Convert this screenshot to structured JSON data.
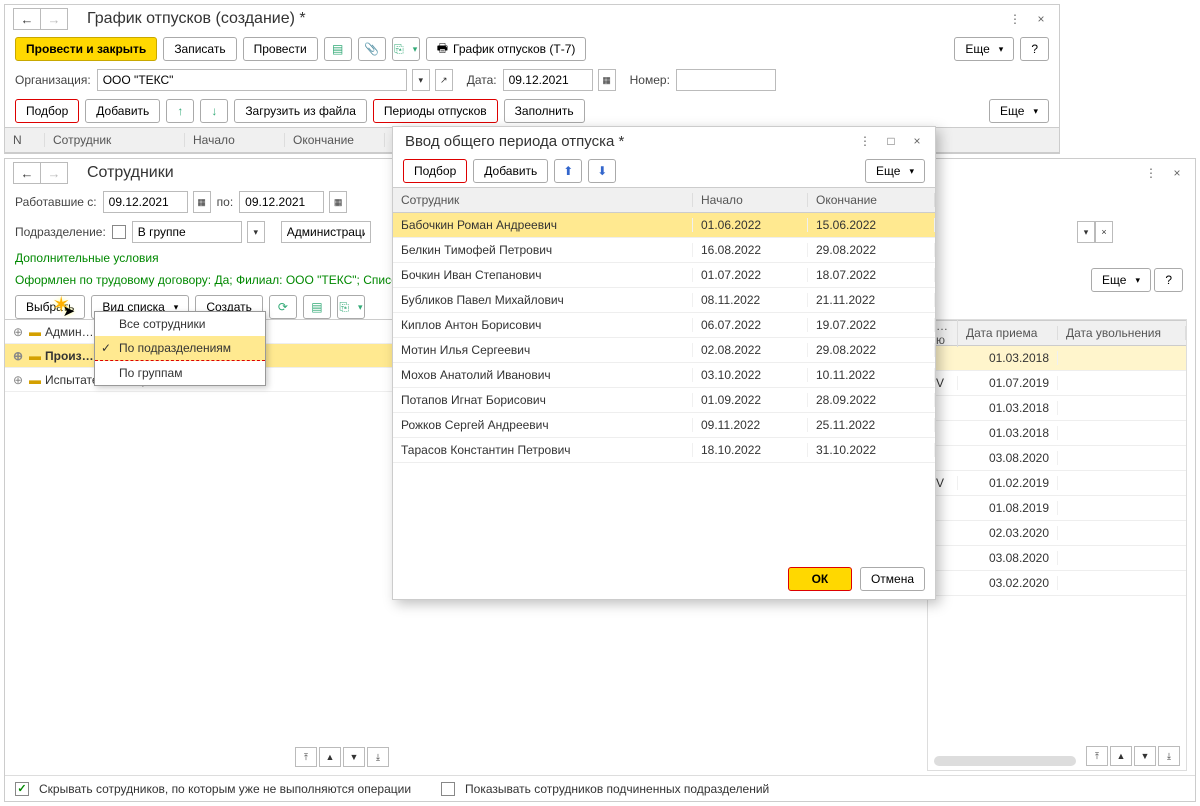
{
  "main_window": {
    "title": "График отпусков (создание) *",
    "toolbar": {
      "post_close": "Провести и закрыть",
      "save": "Записать",
      "post": "Провести",
      "print": "График отпусков (Т-7)",
      "more": "Еще",
      "help": "?"
    },
    "org_label": "Организация:",
    "org_value": "ООО \"ТЕКС\"",
    "date_label": "Дата:",
    "date_value": "09.12.2021",
    "number_label": "Номер:",
    "number_value": "",
    "row2": {
      "select": "Подбор",
      "add": "Добавить",
      "load_file": "Загрузить из файла",
      "periods": "Периоды отпусков",
      "fill": "Заполнить",
      "more": "Еще"
    },
    "cols": {
      "n": "N",
      "emp": "Сотрудник",
      "start": "Начало",
      "end": "Окончание"
    }
  },
  "emp_window": {
    "title": "Сотрудники",
    "worked_from_label": "Работавшие с:",
    "date_from": "09.12.2021",
    "date_to_label": "по:",
    "date_to": "09.12.2021",
    "dept_label": "Подразделение:",
    "in_group": "В группе",
    "admin": "Администрация",
    "extra_cond": "Дополнительные условия",
    "filter_text": "Оформлен по трудовому договору: Да; Филиал: ООО \"ТЕКС\"; Список н",
    "btns": {
      "select": "Выбрать",
      "list_type": "Вид списка",
      "create": "Создать"
    },
    "tree": [
      "Админ…",
      "Произ…",
      "Испытательный цех"
    ],
    "menu": [
      "Все сотрудники",
      "По подразделениям",
      "По группам"
    ],
    "right_cols": {
      "c1": "…ю",
      "c2": "Дата приема",
      "c3": "Дата увольнения"
    },
    "right_rows": [
      {
        "d": "01.03.2018"
      },
      {
        "v": "V",
        "d": "01.07.2019"
      },
      {
        "d": "01.03.2018"
      },
      {
        "d": "01.03.2018"
      },
      {
        "d": "03.08.2020"
      },
      {
        "v": "V",
        "d": "01.02.2019"
      },
      {
        "d": "01.08.2019"
      },
      {
        "d": "02.03.2020"
      },
      {
        "d": "03.08.2020"
      },
      {
        "d": "03.02.2020"
      }
    ],
    "more": "Еще",
    "help": "?",
    "footer": {
      "hide_emp": "Скрывать сотрудников, по которым уже не выполняются операции",
      "show_sub": "Показывать сотрудников подчиненных подразделений"
    }
  },
  "period_dialog": {
    "title": "Ввод общего периода отпуска *",
    "select": "Подбор",
    "add": "Добавить",
    "more": "Еще",
    "cols": {
      "emp": "Сотрудник",
      "start": "Начало",
      "end": "Окончание"
    },
    "rows": [
      {
        "emp": "Бабочкин Роман Андреевич",
        "start": "01.06.2022",
        "end": "15.06.2022"
      },
      {
        "emp": "Белкин Тимофей Петрович",
        "start": "16.08.2022",
        "end": "29.08.2022"
      },
      {
        "emp": "Бочкин Иван Степанович",
        "start": "01.07.2022",
        "end": "18.07.2022"
      },
      {
        "emp": "Бубликов Павел Михайлович",
        "start": "08.11.2022",
        "end": "21.11.2022"
      },
      {
        "emp": "Киплов Антон Борисович",
        "start": "06.07.2022",
        "end": "19.07.2022"
      },
      {
        "emp": "Мотин Илья Сергеевич",
        "start": "02.08.2022",
        "end": "29.08.2022"
      },
      {
        "emp": "Мохов Анатолий Иванович",
        "start": "03.10.2022",
        "end": "10.11.2022"
      },
      {
        "emp": "Потапов Игнат Борисович",
        "start": "01.09.2022",
        "end": "28.09.2022"
      },
      {
        "emp": "Рожков Сергей Андреевич",
        "start": "09.11.2022",
        "end": "25.11.2022"
      },
      {
        "emp": "Тарасов Константин Петрович",
        "start": "18.10.2022",
        "end": "31.10.2022"
      }
    ],
    "ok": "ОК",
    "cancel": "Отмена"
  }
}
